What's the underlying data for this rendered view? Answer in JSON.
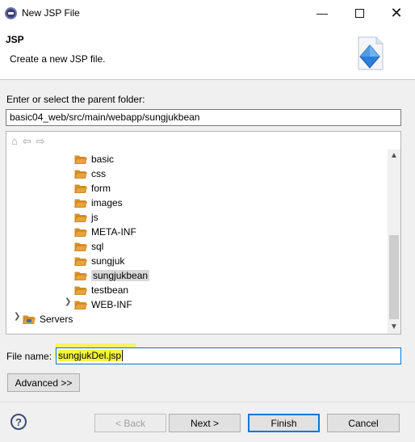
{
  "window": {
    "title": "New JSP File"
  },
  "banner": {
    "title": "JSP",
    "description": "Create a new JSP file."
  },
  "parent_folder": {
    "label": "Enter or select the parent folder:",
    "value": "basic04_web/src/main/webapp/sungjukbean"
  },
  "tree": {
    "items": [
      {
        "label": "basic",
        "selected": false
      },
      {
        "label": "css",
        "selected": false
      },
      {
        "label": "form",
        "selected": false
      },
      {
        "label": "images",
        "selected": false
      },
      {
        "label": "js",
        "selected": false
      },
      {
        "label": "META-INF",
        "selected": false
      },
      {
        "label": "sql",
        "selected": false
      },
      {
        "label": "sungjuk",
        "selected": false
      },
      {
        "label": "sungjukbean",
        "selected": true
      },
      {
        "label": "testbean",
        "selected": false
      },
      {
        "label": "WEB-INF",
        "selected": false
      },
      {
        "label": "Servers",
        "selected": false
      }
    ]
  },
  "file_name": {
    "label": "File name:",
    "value": "sungjukDel.jsp"
  },
  "buttons": {
    "advanced": "Advanced >>",
    "back": "< Back",
    "next": "Next >",
    "finish": "Finish",
    "cancel": "Cancel"
  },
  "colors": {
    "accent": "#0078d7",
    "highlight": "#f5f53a",
    "folder": "#e8a33c"
  }
}
